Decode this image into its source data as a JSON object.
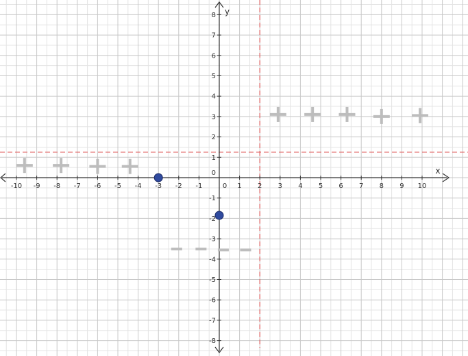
{
  "chart_data": {
    "type": "scatter",
    "title": "",
    "xlabel": "x",
    "ylabel": "y",
    "xlim": [
      -11,
      11.3
    ],
    "ylim": [
      -8.3,
      8.5
    ],
    "grid": true,
    "x_ticks": [
      -10,
      -9,
      -8,
      -7,
      -6,
      -5,
      -4,
      -3,
      -2,
      -1,
      1,
      2,
      3,
      4,
      5,
      6,
      7,
      8,
      9,
      10
    ],
    "y_ticks": [
      -8,
      -7,
      -6,
      -5,
      -4,
      -3,
      -2,
      -1,
      1,
      2,
      3,
      4,
      5,
      6,
      7,
      8
    ],
    "origin_label": "0",
    "asymptotes": [
      {
        "orientation": "vertical",
        "value": 2,
        "color": "#e06666",
        "style": "dashed"
      },
      {
        "orientation": "horizontal",
        "value": 1.25,
        "color": "#e06666",
        "style": "dashed"
      }
    ],
    "series": [
      {
        "marker": "plus",
        "color": "#bdbdbd",
        "points": [
          {
            "x": -9.6,
            "y": 0.6
          },
          {
            "x": -7.8,
            "y": 0.6
          },
          {
            "x": -6.0,
            "y": 0.55
          },
          {
            "x": -4.4,
            "y": 0.55
          },
          {
            "x": 2.9,
            "y": 3.1
          },
          {
            "x": 4.6,
            "y": 3.1
          },
          {
            "x": 6.3,
            "y": 3.1
          },
          {
            "x": 8.0,
            "y": 3.0
          },
          {
            "x": 9.9,
            "y": 3.05
          }
        ]
      },
      {
        "marker": "minus",
        "color": "#bdbdbd",
        "points": [
          {
            "x": -2.1,
            "y": -3.5
          },
          {
            "x": -0.9,
            "y": -3.5
          },
          {
            "x": 0.2,
            "y": -3.55
          },
          {
            "x": 1.3,
            "y": -3.55
          }
        ]
      },
      {
        "marker": "circle",
        "color": "#2f4a9e",
        "points": [
          {
            "x": -3,
            "y": 0
          },
          {
            "x": 0,
            "y": -1.85
          }
        ]
      }
    ]
  }
}
